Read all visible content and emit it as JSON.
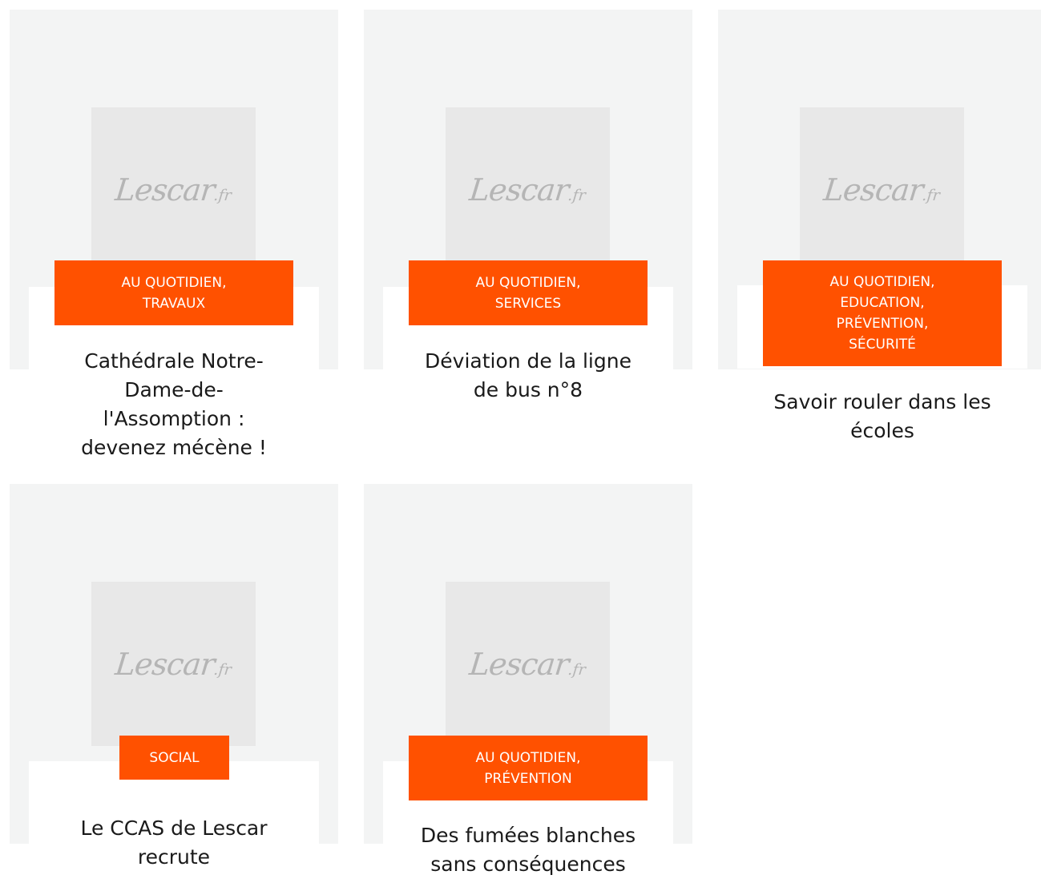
{
  "logo": {
    "main": "Lescar",
    "suffix": ".fr"
  },
  "colors": {
    "accent": "#ff5100",
    "card_bg": "#f3f4f4",
    "thumb_bg": "#e8e8e8",
    "logo": "#b5b5b5"
  },
  "articles": [
    {
      "tags_line1": "AU QUOTIDIEN,",
      "tags_line2": "TRAVAUX",
      "title_line1": "Cathédrale Notre-",
      "title_line2": "Dame-de-",
      "title_line3": "l'Assomption :",
      "title_line4": "devenez mécène !"
    },
    {
      "tags_line1": "AU QUOTIDIEN,",
      "tags_line2": "SERVICES",
      "title_line1": "Déviation de la ligne",
      "title_line2": "de bus n°8"
    },
    {
      "tags_line1": "AU QUOTIDIEN,",
      "tags_line2": "EDUCATION,",
      "tags_line3": "PRÉVENTION,",
      "tags_line4": "SÉCURITÉ",
      "title_line1": "Savoir rouler dans les",
      "title_line2": "écoles"
    },
    {
      "tags_line1": "SOCIAL",
      "title_line1": "Le CCAS de Lescar",
      "title_line2": "recrute"
    },
    {
      "tags_line1": "AU QUOTIDIEN,",
      "tags_line2": "PRÉVENTION",
      "title_line1": "Des fumées blanches",
      "title_line2": "sans conséquences"
    }
  ]
}
